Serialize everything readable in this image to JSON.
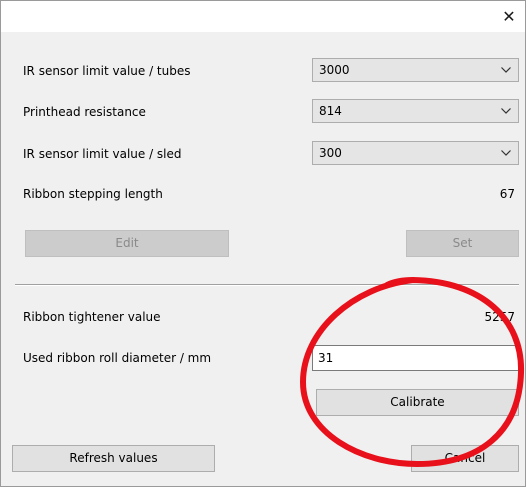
{
  "window": {
    "close_symbol": "✕"
  },
  "rows": [
    {
      "label": "IR sensor limit value / tubes",
      "value": "3000"
    },
    {
      "label": "Printhead resistance",
      "value": "814"
    },
    {
      "label": "IR sensor limit value / sled",
      "value": "300"
    }
  ],
  "ribbon_stepping": {
    "label": "Ribbon stepping length",
    "value": "67"
  },
  "buttons": {
    "edit": "Edit",
    "set": "Set",
    "calibrate": "Calibrate",
    "refresh": "Refresh values",
    "cancel": "Cancel"
  },
  "ribbon_tightener": {
    "label": "Ribbon tightener value",
    "value": "5257"
  },
  "roll_diameter": {
    "label": "Used ribbon roll diameter / mm",
    "value": "31"
  },
  "annotation": {
    "color": "#e8101a"
  }
}
